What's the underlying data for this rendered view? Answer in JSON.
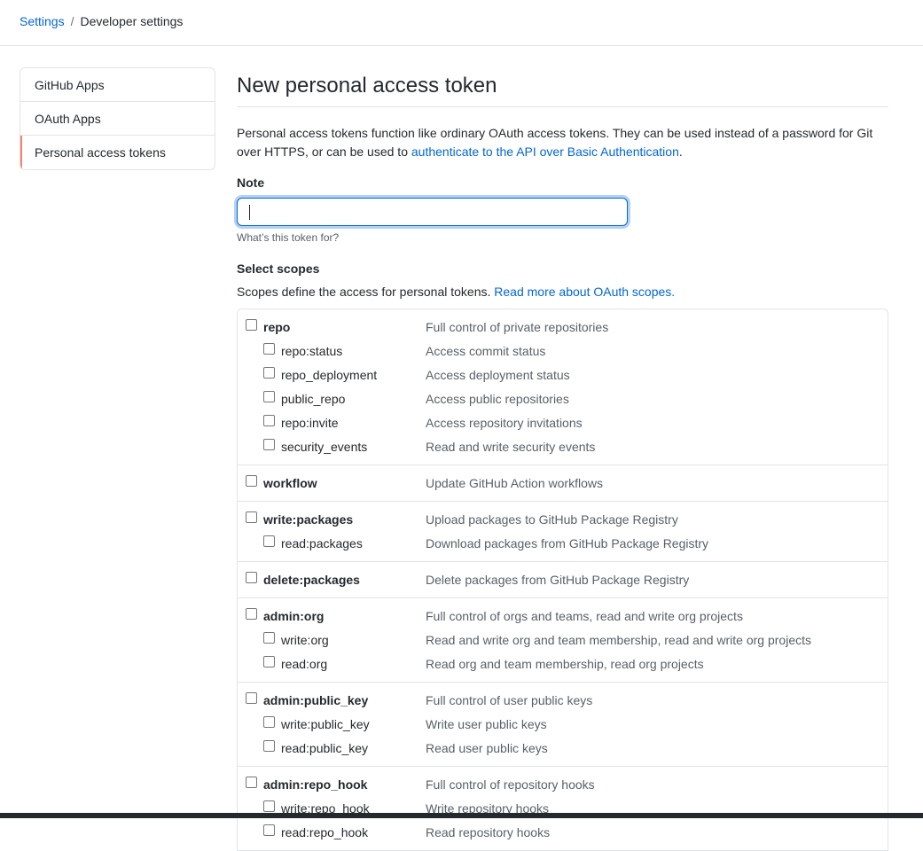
{
  "breadcrumb": {
    "settings": "Settings",
    "separator": "/",
    "current": "Developer settings"
  },
  "sidenav": {
    "items": [
      {
        "label": "GitHub Apps"
      },
      {
        "label": "OAuth Apps"
      },
      {
        "label": "Personal access tokens",
        "selected": true
      }
    ]
  },
  "main": {
    "title": "New personal access token",
    "intro_text": "Personal access tokens function like ordinary OAuth access tokens. They can be used instead of a password for Git over HTTPS, or can be used to ",
    "intro_link": "authenticate to the API over Basic Authentication",
    "intro_end": ".",
    "note_label": "Note",
    "note_value": "",
    "note_hint": "What’s this token for?",
    "scopes_title": "Select scopes",
    "scopes_desc": "Scopes define the access for personal tokens. ",
    "scopes_link": "Read more about OAuth scopes."
  },
  "scopes": [
    {
      "name": "repo",
      "desc": "Full control of private repositories",
      "children": [
        {
          "name": "repo:status",
          "desc": "Access commit status"
        },
        {
          "name": "repo_deployment",
          "desc": "Access deployment status"
        },
        {
          "name": "public_repo",
          "desc": "Access public repositories"
        },
        {
          "name": "repo:invite",
          "desc": "Access repository invitations"
        },
        {
          "name": "security_events",
          "desc": "Read and write security events"
        }
      ]
    },
    {
      "name": "workflow",
      "desc": "Update GitHub Action workflows",
      "children": []
    },
    {
      "name": "write:packages",
      "desc": "Upload packages to GitHub Package Registry",
      "children": [
        {
          "name": "read:packages",
          "desc": "Download packages from GitHub Package Registry"
        }
      ]
    },
    {
      "name": "delete:packages",
      "desc": "Delete packages from GitHub Package Registry",
      "children": []
    },
    {
      "name": "admin:org",
      "desc": "Full control of orgs and teams, read and write org projects",
      "children": [
        {
          "name": "write:org",
          "desc": "Read and write org and team membership, read and write org projects"
        },
        {
          "name": "read:org",
          "desc": "Read org and team membership, read org projects"
        }
      ]
    },
    {
      "name": "admin:public_key",
      "desc": "Full control of user public keys",
      "children": [
        {
          "name": "write:public_key",
          "desc": "Write user public keys"
        },
        {
          "name": "read:public_key",
          "desc": "Read user public keys"
        }
      ]
    },
    {
      "name": "admin:repo_hook",
      "desc": "Full control of repository hooks",
      "children": [
        {
          "name": "write:repo_hook",
          "desc": "Write repository hooks"
        },
        {
          "name": "read:repo_hook",
          "desc": "Read repository hooks"
        }
      ]
    }
  ]
}
